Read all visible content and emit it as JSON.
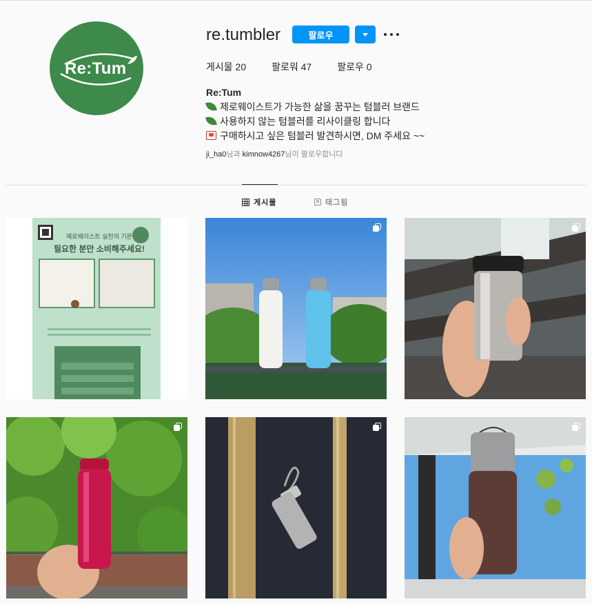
{
  "profile": {
    "username": "re.tumbler",
    "logo_text": "Re:Tum",
    "follow_label": "팔로우",
    "stats": {
      "posts": "게시물 20",
      "followers": "팔로워 47",
      "following": "팔로우 0"
    },
    "bio": {
      "name": "Re:Tum",
      "line1": "제로웨이스트가 가능한 삶을 꿈꾸는 텀블러 브랜드",
      "line2": "사용하지 않는 텀블러를 리사이클링 합니다",
      "line3": "구매하시고 싶은 텀블러 발견하시면, DM 주세요 ~~"
    },
    "followed_by": {
      "user1": "ji_ha0",
      "mid": "님과 ",
      "user2": "kimnow4267",
      "end": "님이 팔로우합니다"
    }
  },
  "tabs": {
    "posts": "게시물",
    "tagged": "태그됨"
  },
  "posts": [
    {
      "title": "필요한 분만 소비해주세요!",
      "subtitle": "제로웨이스트 실천의 기본",
      "multi": false
    },
    {
      "multi": true
    },
    {
      "multi": true
    },
    {
      "multi": true
    },
    {
      "multi": true
    },
    {
      "multi": true
    }
  ],
  "colors": {
    "accent": "#0095f6",
    "brand_green": "#3d8a4b"
  }
}
